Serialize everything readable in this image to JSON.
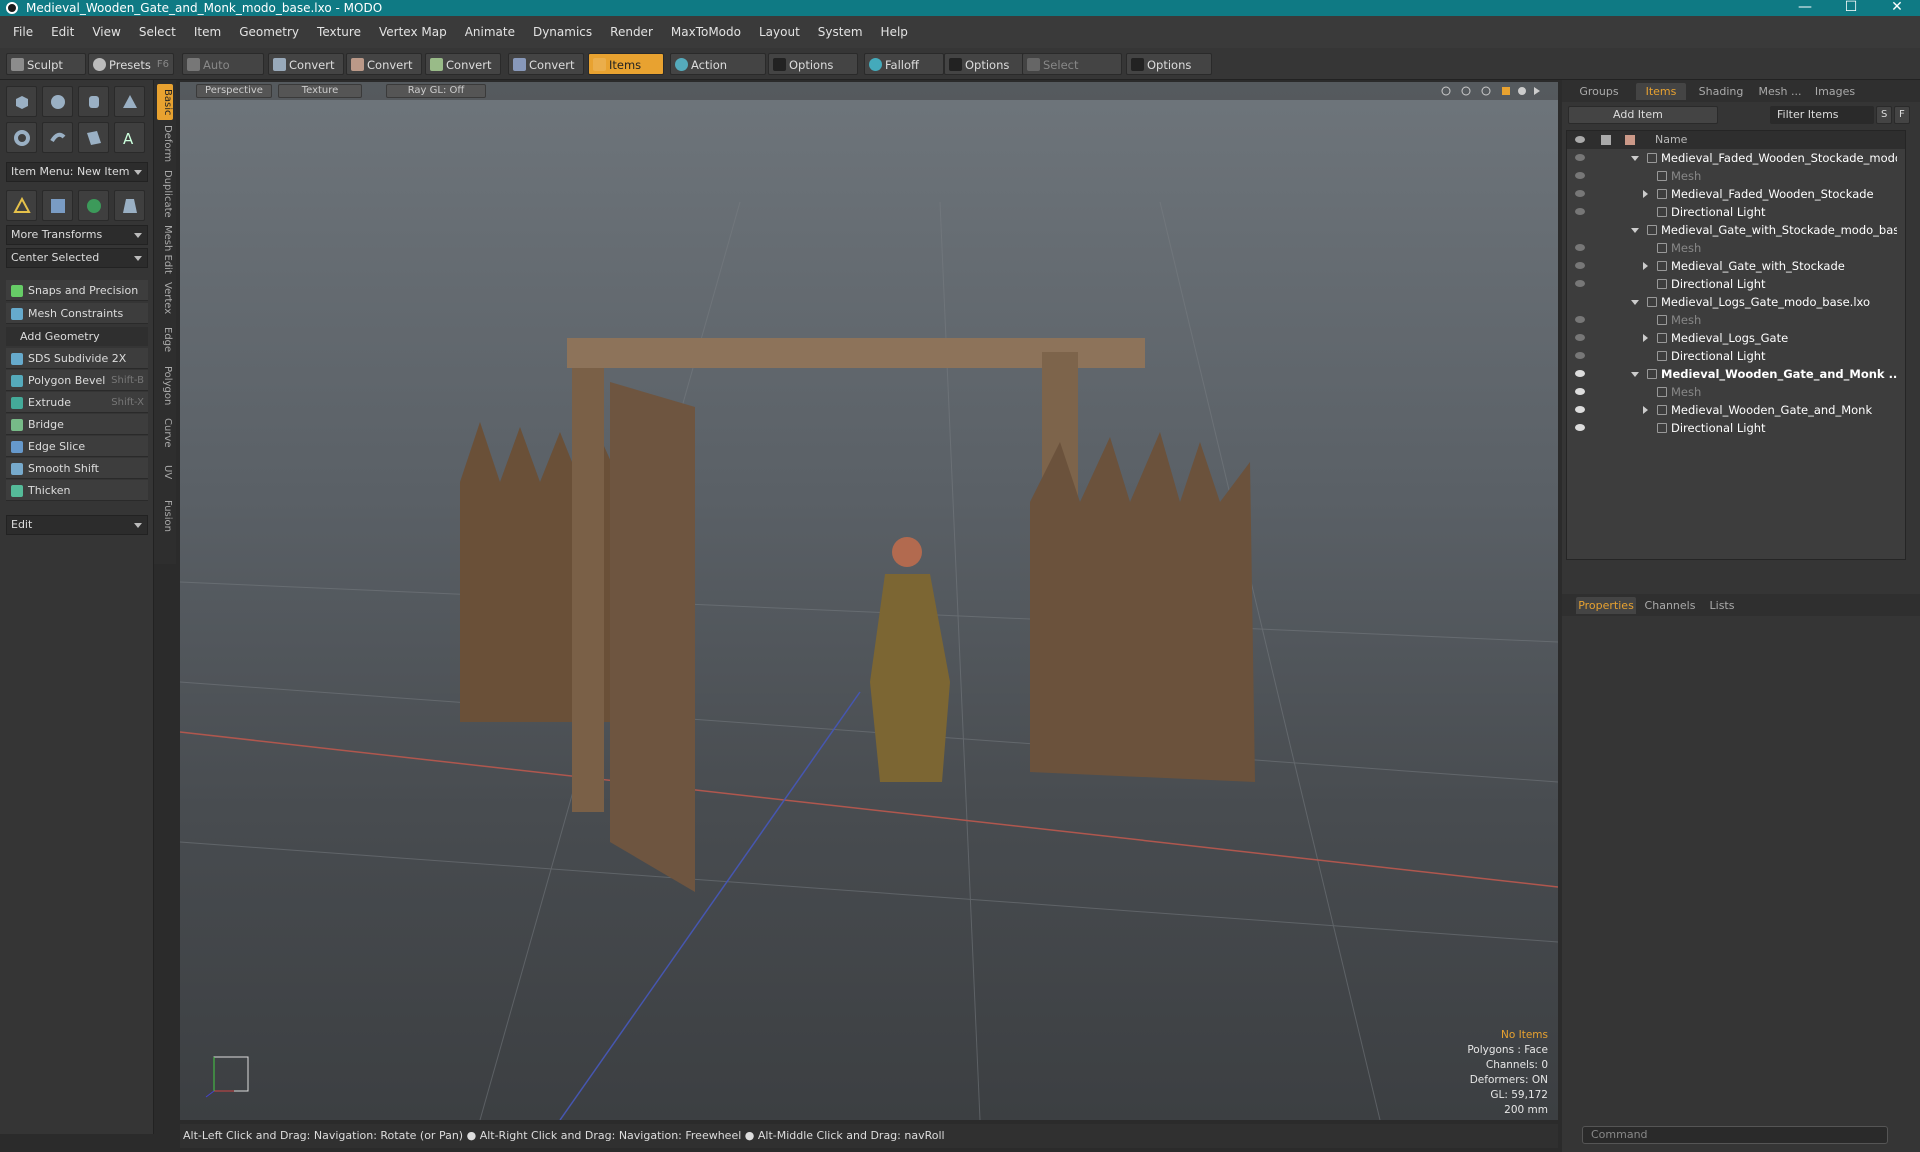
{
  "window": {
    "title": "Medieval_Wooden_Gate_and_Monk_modo_base.lxo - MODO",
    "min": "—",
    "max": "☐",
    "close": "✕"
  },
  "menu": [
    "File",
    "Edit",
    "View",
    "Select",
    "Item",
    "Geometry",
    "Texture",
    "Vertex Map",
    "Animate",
    "Dynamics",
    "Render",
    "MaxToModo",
    "Layout",
    "System",
    "Help"
  ],
  "toolbar": {
    "sculpt": "Sculpt",
    "presets": "Presets",
    "presets_key": "F6",
    "auto_select": "Auto Select",
    "convert1": "Convert",
    "convert2": "Convert",
    "convert3": "Convert",
    "convert4": "Convert",
    "items": "Items",
    "action_center": "Action Center",
    "options1": "Options",
    "falloff": "Falloff",
    "options2": "Options",
    "select_through": "Select Through",
    "options3": "Options"
  },
  "left": {
    "item_menu": "Item Menu: New Item",
    "more_transforms": "More Transforms",
    "center_selected": "Center Selected",
    "snaps": "Snaps and Precision",
    "mesh_constraints": "Mesh Constraints",
    "add_geometry": "Add Geometry",
    "tools": [
      {
        "label": "SDS Subdivide 2X",
        "key": ""
      },
      {
        "label": "Polygon Bevel",
        "key": "Shift-B"
      },
      {
        "label": "Extrude",
        "key": "Shift-X"
      },
      {
        "label": "Bridge",
        "key": ""
      },
      {
        "label": "Edge Slice",
        "key": ""
      },
      {
        "label": "Smooth Shift",
        "key": ""
      },
      {
        "label": "Thicken",
        "key": ""
      }
    ],
    "edit": "Edit"
  },
  "vtabs": [
    "Basic",
    "Deform",
    "Duplicate",
    "Mesh Edit",
    "Vertex",
    "Edge",
    "Polygon",
    "Curve",
    "UV",
    "Fusion"
  ],
  "viewport": {
    "perspective": "Perspective",
    "texture": "Texture",
    "raygl": "Ray GL: Off",
    "hud": {
      "items": "No Items",
      "polygons": "Polygons : Face",
      "channels": "Channels: 0",
      "deformers": "Deformers: ON",
      "gl": "GL: 59,172",
      "scale": "200 mm"
    }
  },
  "status": "Alt-Left Click and Drag: Navigation: Rotate (or Pan) ● Alt-Right Click and Drag: Navigation: Freewheel ● Alt-Middle Click and Drag: navRoll",
  "right": {
    "tabs": [
      "Groups",
      "Items",
      "Shading",
      "Mesh ...",
      "Images"
    ],
    "add_item": "Add Item",
    "filter": "Filter Items",
    "s": "S",
    "f": "F",
    "name_col": "Name",
    "rows": [
      {
        "label": "Medieval_Faded_Wooden_Stockade_modo ...",
        "type": "scene",
        "depth": 0,
        "expand": "open",
        "eye": "dim"
      },
      {
        "label": "Mesh",
        "type": "mesh",
        "depth": 1,
        "expand": "none",
        "eye": "dim",
        "dim": true
      },
      {
        "label": "Medieval_Faded_Wooden_Stockade",
        "type": "mesh",
        "depth": 1,
        "expand": "closed",
        "eye": "dim"
      },
      {
        "label": "Directional Light",
        "type": "light",
        "depth": 1,
        "expand": "none",
        "eye": "dim"
      },
      {
        "label": "Medieval_Gate_with_Stockade_modo_bas ...",
        "type": "scene",
        "depth": 0,
        "expand": "open",
        "eye": "none"
      },
      {
        "label": "Mesh",
        "type": "mesh",
        "depth": 1,
        "expand": "none",
        "eye": "dim",
        "dim": true
      },
      {
        "label": "Medieval_Gate_with_Stockade",
        "type": "mesh",
        "depth": 1,
        "expand": "closed",
        "eye": "dim"
      },
      {
        "label": "Directional Light",
        "type": "light",
        "depth": 1,
        "expand": "none",
        "eye": "dim"
      },
      {
        "label": "Medieval_Logs_Gate_modo_base.lxo",
        "type": "scene",
        "depth": 0,
        "expand": "open",
        "eye": "none"
      },
      {
        "label": "Mesh",
        "type": "mesh",
        "depth": 1,
        "expand": "none",
        "eye": "dim",
        "dim": true
      },
      {
        "label": "Medieval_Logs_Gate",
        "type": "mesh",
        "depth": 1,
        "expand": "closed",
        "eye": "dim"
      },
      {
        "label": "Directional Light",
        "type": "light",
        "depth": 1,
        "expand": "none",
        "eye": "dim"
      },
      {
        "label": "Medieval_Wooden_Gate_and_Monk ...",
        "type": "scene",
        "depth": 0,
        "expand": "open",
        "eye": "on",
        "bold": true
      },
      {
        "label": "Mesh",
        "type": "mesh",
        "depth": 1,
        "expand": "none",
        "eye": "on",
        "dim": true
      },
      {
        "label": "Medieval_Wooden_Gate_and_Monk",
        "type": "mesh",
        "depth": 1,
        "expand": "closed",
        "eye": "on"
      },
      {
        "label": "Directional Light",
        "type": "light",
        "depth": 1,
        "expand": "none",
        "eye": "on"
      }
    ],
    "prop_tabs": [
      "Properties",
      "Channels",
      "Lists"
    ],
    "command": "Command"
  },
  "colors": {
    "accent": "#e8a230",
    "title": "#0f7a84"
  }
}
